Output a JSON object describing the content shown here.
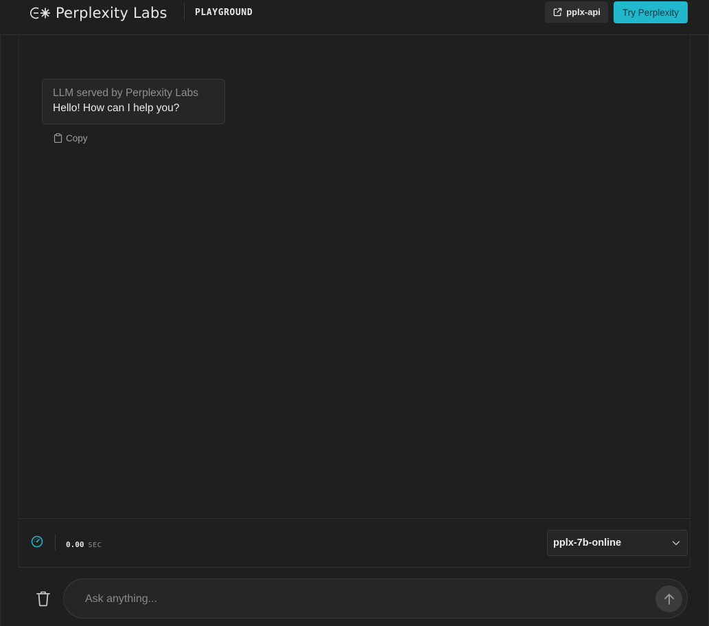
{
  "header": {
    "brand": "Perplexity Labs",
    "section": "PLAYGROUND",
    "api_button": "pplx-api",
    "try_button": "Try Perplexity"
  },
  "chat": {
    "messages": [
      {
        "label": "LLM served by Perplexity Labs",
        "text": "Hello! How can I help you?",
        "copy_label": "Copy"
      }
    ]
  },
  "status": {
    "elapsed": "0.00",
    "unit": "SEC",
    "model": "pplx-7b-online"
  },
  "input": {
    "placeholder": "Ask anything..."
  },
  "colors": {
    "background": "#1f1f1f",
    "accent": "#21b8cd",
    "panel": "#262626"
  },
  "icons": {
    "logo": "perplexity-logo-icon",
    "external_link": "external-link-icon",
    "copy": "clipboard-icon",
    "speed": "speedometer-icon",
    "dropdown": "chevron-down-icon",
    "trash": "trash-icon",
    "send": "arrow-up-icon"
  }
}
